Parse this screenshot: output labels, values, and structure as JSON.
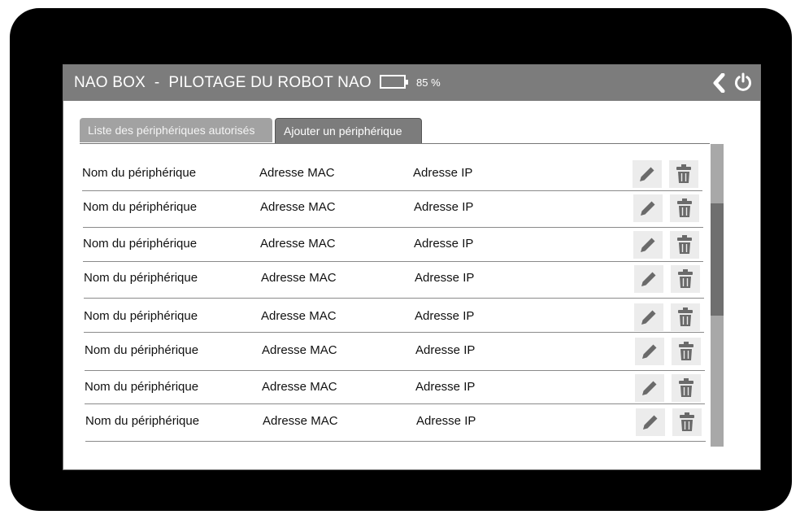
{
  "header": {
    "title": "NAO BOX  -  PILOTAGE DU ROBOT NAO",
    "battery_level": "85 %",
    "back_icon": "chevron-left-icon",
    "power_icon": "power-icon"
  },
  "tabs": [
    {
      "label": "Liste des périphériques autorisés"
    },
    {
      "label": "Ajouter un périphérique"
    }
  ],
  "devices": [
    {
      "name": "Nom du périphérique",
      "mac": "Adresse MAC",
      "ip": "Adresse IP"
    },
    {
      "name": "Nom du périphérique",
      "mac": "Adresse MAC",
      "ip": "Adresse IP"
    },
    {
      "name": "Nom du périphérique",
      "mac": "Adresse MAC",
      "ip": "Adresse IP"
    },
    {
      "name": "Nom du périphérique",
      "mac": "Adresse MAC",
      "ip": "Adresse IP"
    },
    {
      "name": "Nom du périphérique",
      "mac": "Adresse MAC",
      "ip": "Adresse IP"
    },
    {
      "name": "Nom du périphérique",
      "mac": "Adresse MAC",
      "ip": "Adresse IP"
    },
    {
      "name": "Nom du périphérique",
      "mac": "Adresse MAC",
      "ip": "Adresse IP"
    },
    {
      "name": "Nom du périphérique",
      "mac": "Adresse MAC",
      "ip": "Adresse IP"
    }
  ],
  "row_actions": {
    "edit_icon": "pencil-icon",
    "delete_icon": "trash-icon"
  },
  "colors": {
    "header_bar": "#7c7c7c",
    "device_frame": "#000000",
    "action_icon": "#6a6a6a"
  }
}
